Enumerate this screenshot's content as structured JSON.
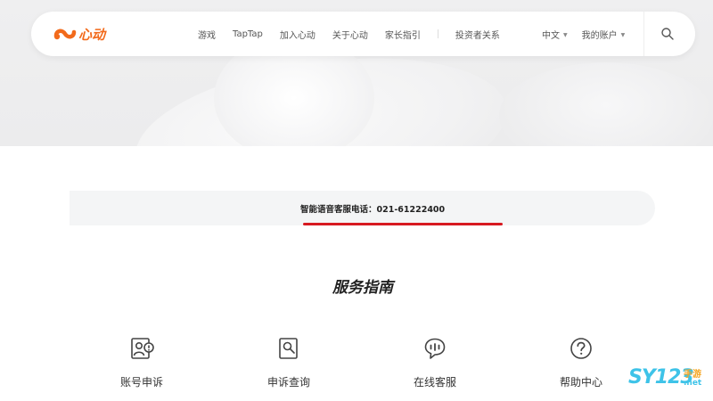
{
  "header": {
    "logo_text": "心动",
    "nav_items": [
      "游戏",
      "TapTap",
      "加入心动",
      "关于心动",
      "家长指引",
      "投资者关系"
    ],
    "language": "中文",
    "account": "我的账户",
    "brand_color": "#f26a1b"
  },
  "hotline": {
    "text": "智能语音客服电话：021-61222400",
    "accent_color": "#d71920"
  },
  "section": {
    "title": "服务指南"
  },
  "services": [
    {
      "label": "账号申诉",
      "icon": "account-appeal-icon"
    },
    {
      "label": "申诉查询",
      "icon": "appeal-search-icon"
    },
    {
      "label": "在线客服",
      "icon": "chat-icon"
    },
    {
      "label": "帮助中心",
      "icon": "help-icon"
    }
  ],
  "watermark": {
    "main": "SY123",
    "sub1": "手游",
    "sub2": ".net"
  }
}
